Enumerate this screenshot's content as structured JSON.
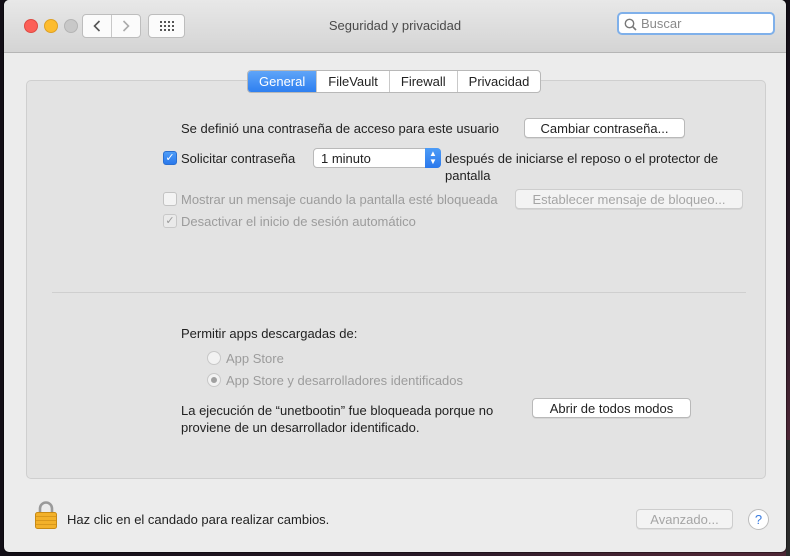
{
  "window": {
    "title": "Seguridad y privacidad"
  },
  "search": {
    "placeholder": "Buscar",
    "value": ""
  },
  "tabs": [
    {
      "label": "General",
      "active": true
    },
    {
      "label": "FileVault",
      "active": false
    },
    {
      "label": "Firewall",
      "active": false
    },
    {
      "label": "Privacidad",
      "active": false
    }
  ],
  "general": {
    "password_set_text": "Se definió una contraseña de acceso para este usuario",
    "change_password_button": "Cambiar contraseña...",
    "require_password": {
      "label": "Solicitar contraseña",
      "checked": true
    },
    "require_select": {
      "value": "1 minuto"
    },
    "after_sleep_line1": "después de iniciarse el reposo o el protector de",
    "after_sleep_line2": "pantalla",
    "show_message": {
      "label": "Mostrar un mensaje cuando la pantalla esté bloqueada",
      "checked": false,
      "enabled": false
    },
    "set_lock_message_button": "Establecer mensaje de bloqueo...",
    "disable_auto_login": {
      "label": "Desactivar el inicio de sesión automático",
      "checked": true,
      "enabled": false
    },
    "allow_apps_title": "Permitir apps descargadas de:",
    "radio_app_store": {
      "label": "App Store",
      "selected": false
    },
    "radio_identified": {
      "label": "App Store y desarrolladores identificados",
      "selected": true
    },
    "blocked_line1": "La ejecución de “unetbootin” fue bloqueada porque no",
    "blocked_line2": "proviene de un desarrollador identificado.",
    "open_anyway_button": "Abrir de todos modos"
  },
  "footer": {
    "lock_text": "Haz clic en el candado para realizar cambios.",
    "advanced_button": "Avanzado...",
    "help_label": "?"
  },
  "colors": {
    "accent": "#2e7ff0",
    "lock": "#f3b12a"
  }
}
